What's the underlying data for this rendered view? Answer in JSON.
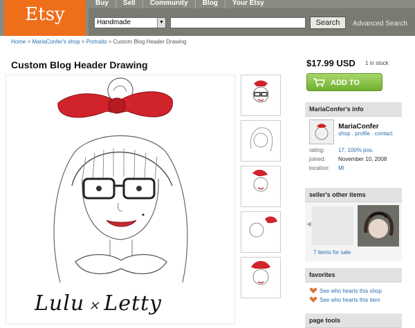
{
  "header": {
    "logo": "Etsy",
    "nav": [
      "Buy",
      "Sell",
      "Community",
      "Blog",
      "Your Etsy"
    ],
    "search_category": "Handmade",
    "search_button": "Search",
    "advanced_search": "Advanced Search"
  },
  "breadcrumb": {
    "home": "Home",
    "shop": "MariaConfer's shop",
    "section": "Portraits",
    "current": "Custom Blog Header Drawing",
    "sep": " > "
  },
  "listing": {
    "title": "Custom Blog Header Drawing",
    "price": "$17.99 USD",
    "stock": "1 in stock",
    "add_to_cart": "ADD TO CART",
    "signature_left": "Lulu",
    "signature_right": "Letty"
  },
  "seller": {
    "header": "MariaConfer's info",
    "name": "MariaConfer",
    "links": "shop . profile . contact",
    "rating_label": "rating:",
    "rating_value": "17, 100% pos.",
    "joined_label": "joined:",
    "joined_value": "November 10, 2008",
    "location_label": "location:",
    "location_value": "MI"
  },
  "other_items": {
    "header": "seller's other items",
    "link": "7 items for sale"
  },
  "favorites": {
    "header": "favorites",
    "shop_link": "See who hearts this shop",
    "item_link": "See who hearts this item"
  },
  "page_tools": {
    "header": "page tools"
  },
  "colors": {
    "etsy_orange": "#ee6e1a",
    "header_gray": "#8a8a80",
    "link_blue": "#2a6fb0",
    "cart_green": "#7bbd3a",
    "bow_red": "#d0232b"
  }
}
